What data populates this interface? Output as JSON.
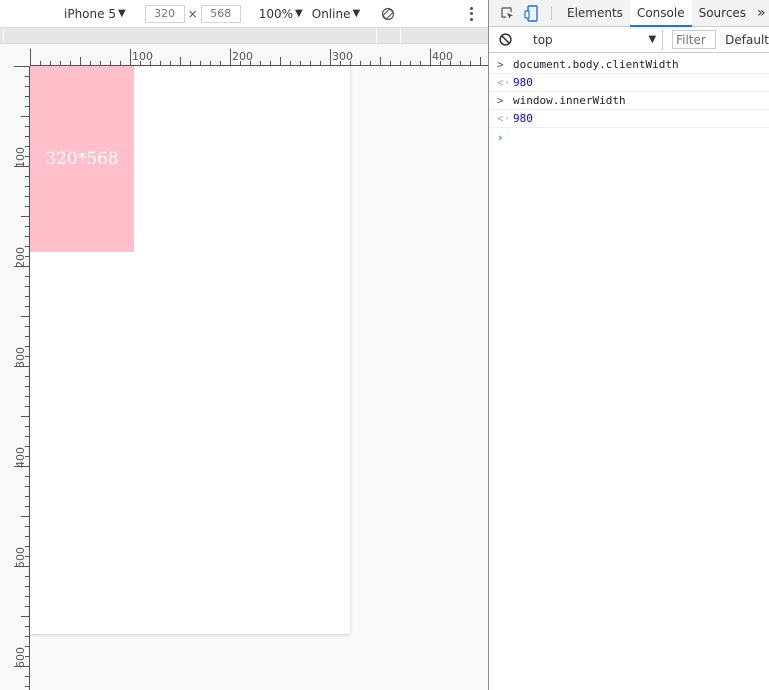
{
  "device_toolbar": {
    "device": "iPhone 5",
    "width": "320",
    "height": "568",
    "dimension_separator": "×",
    "zoom": "100%",
    "network": "Online"
  },
  "ruler": {
    "horizontal_labels": [
      "100",
      "200",
      "300",
      "400"
    ],
    "vertical_labels": [
      "100",
      "200",
      "300",
      "400",
      "500",
      "600"
    ]
  },
  "page": {
    "box_label": "320*568",
    "box_color": "#ffc0cb"
  },
  "devtools": {
    "tabs": [
      {
        "label": "Elements",
        "active": false
      },
      {
        "label": "Console",
        "active": true
      },
      {
        "label": "Sources",
        "active": false
      }
    ],
    "context": "top",
    "filter_placeholder": "Filter",
    "levels": "Default",
    "accent_color": "#1a73e8"
  },
  "console": {
    "entries": [
      {
        "kind": "input",
        "text": "document.body.clientWidth"
      },
      {
        "kind": "result",
        "text": "980"
      },
      {
        "kind": "input",
        "text": "window.innerWidth"
      },
      {
        "kind": "result",
        "text": "980"
      }
    ]
  }
}
